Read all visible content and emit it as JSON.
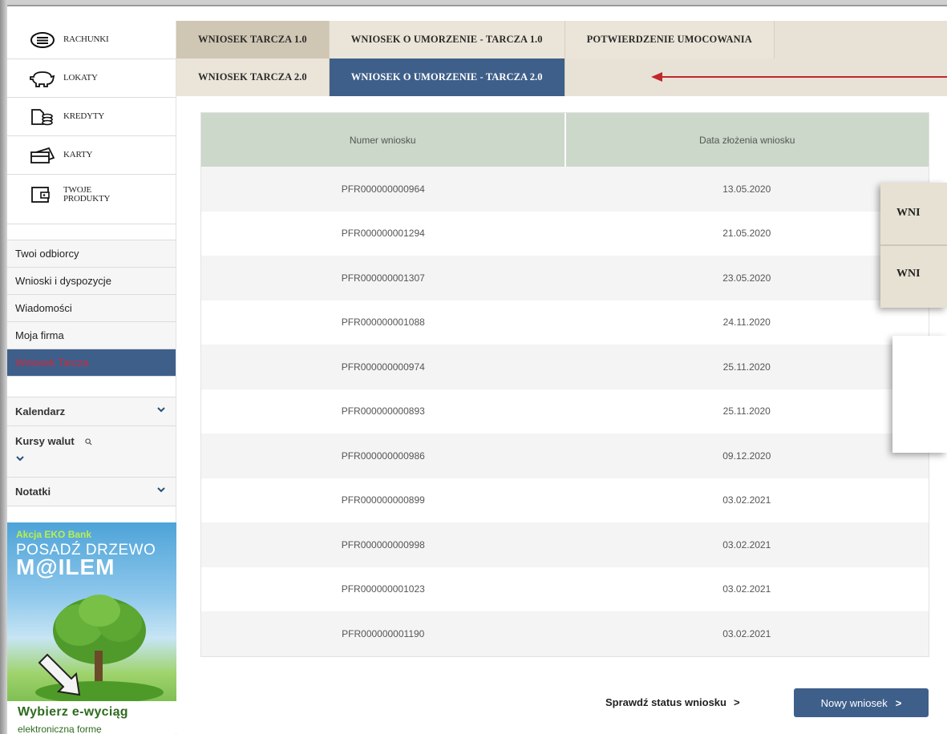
{
  "sidebar": {
    "products": [
      {
        "label": "RACHUNKI",
        "icon": "accounts-icon"
      },
      {
        "label": "LOKATY",
        "icon": "piggy-bank-icon"
      },
      {
        "label": "KREDYTY",
        "icon": "credit-icon"
      },
      {
        "label": "KARTY",
        "icon": "card-icon"
      },
      {
        "label_line1": "TWOJE",
        "label_line2": "PRODUKTY",
        "icon": "wallet-icon"
      }
    ],
    "menu": [
      {
        "label": "Twoi odbiorcy"
      },
      {
        "label": "Wnioski i dyspozycje"
      },
      {
        "label": "Wiadomości"
      },
      {
        "label": "Moja firma"
      },
      {
        "label": "Wniosek Tarcza",
        "active": true
      }
    ],
    "tools": {
      "calendar": "Kalendarz",
      "rates": "Kursy walut",
      "notes": "Notatki"
    },
    "promo": {
      "line1": "Akcja EKO Bank",
      "line2": "POSADŹ DRZEWO",
      "line3": "M@ILEM",
      "cta": "Wybierz e-wyciąg",
      "cta2": "elektroniczną formę"
    }
  },
  "tabs": {
    "row1": [
      "WNIOSEK TARCZA 1.0",
      "WNIOSEK O UMORZENIE - TARCZA 1.0",
      "POTWIERDZENIE UMOCOWANIA"
    ],
    "row2": [
      "WNIOSEK TARCZA 2.0",
      "WNIOSEK O UMORZENIE - TARCZA 2.0"
    ],
    "active": "WNIOSEK O UMORZENIE - TARCZA 2.0"
  },
  "table": {
    "headers": [
      "Numer wniosku",
      "Data złożenia wniosku"
    ],
    "rows": [
      [
        "PFR000000000964",
        "13.05.2020"
      ],
      [
        "PFR000000001294",
        "21.05.2020"
      ],
      [
        "PFR000000001307",
        "23.05.2020"
      ],
      [
        "PFR000000001088",
        "24.11.2020"
      ],
      [
        "PFR000000000974",
        "25.11.2020"
      ],
      [
        "PFR000000000893",
        "25.11.2020"
      ],
      [
        "PFR000000000986",
        "09.12.2020"
      ],
      [
        "PFR000000000899",
        "03.02.2021"
      ],
      [
        "PFR000000000998",
        "03.02.2021"
      ],
      [
        "PFR000000001023",
        "03.02.2021"
      ],
      [
        "PFR000000001190",
        "03.02.2021"
      ]
    ]
  },
  "overlay": {
    "item1": "WNI",
    "item2": "WNI"
  },
  "actions": {
    "status_link": "Sprawdź status wniosku",
    "new_button": "Nowy wniosek",
    "chevron": ">"
  },
  "colors": {
    "accent": "#3e5f8a",
    "active_menu_text": "#d0283a",
    "table_header": "#ccd8ca",
    "tab_bg": "#e8e2d6",
    "arrow": "#c0282c"
  }
}
